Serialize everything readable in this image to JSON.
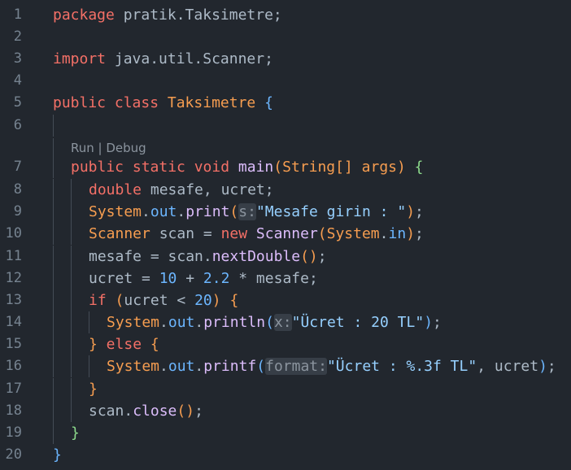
{
  "editor": {
    "line_numbers": [
      "1",
      "2",
      "3",
      "4",
      "5",
      "6",
      "7",
      "8",
      "9",
      "10",
      "11",
      "12",
      "13",
      "14",
      "15",
      "16",
      "17",
      "18",
      "19",
      "20"
    ],
    "codelens": {
      "run": "Run",
      "separator": " | ",
      "debug": "Debug"
    },
    "line1": {
      "kw": "package",
      "rest": " pratik.Taksimetre;"
    },
    "line3": {
      "kw": "import",
      "rest": " java.util.Scanner;"
    },
    "line5": {
      "kw": "public class",
      "name": " Taksimetre",
      "brace": " {"
    },
    "line7": {
      "kw": "public static void",
      "fn": " main",
      "open": "(",
      "type": "String[]",
      "arg": " args",
      "close": ")",
      "brace": " {"
    },
    "line8": {
      "type": "double",
      "rest": " mesafe, ucret;"
    },
    "line9": {
      "cls": "System",
      "dot1": ".",
      "field": "out",
      "dot2": ".",
      "fn": "print",
      "open": "(",
      "hint": "s:",
      "str": "\"Mesafe girin : \"",
      "close": ")",
      "end": ";"
    },
    "line10": {
      "type": "Scanner",
      "mid": " scan = ",
      "kw": "new",
      "sp": " ",
      "cls": "Scanner",
      "open": "(",
      "arg_cls": "System",
      "dot": ".",
      "field": "in",
      "close": ")",
      "end": ";"
    },
    "line11": {
      "pre": "mesafe = scan.",
      "fn": "nextDouble",
      "parens": "()",
      "end": ";"
    },
    "line12": {
      "pre": "ucret = ",
      "n1": "10",
      "op1": " + ",
      "n2": "2.2",
      "op2": " * mesafe;"
    },
    "line13": {
      "kw": "if",
      "sp": " ",
      "open": "(",
      "pre": "ucret < ",
      "num": "20",
      "close": ")",
      "brace": " {"
    },
    "line14": {
      "cls": "System",
      "dot1": ".",
      "field": "out",
      "dot2": ".",
      "fn": "println",
      "open": "(",
      "hint": "x:",
      "str": "\"Ücret : 20 TL\"",
      "close": ")",
      "end": ";"
    },
    "line15": {
      "close_brace": "}",
      "kw": " else",
      "brace": " {"
    },
    "line16": {
      "cls": "System",
      "dot1": ".",
      "field": "out",
      "dot2": ".",
      "fn": "printf",
      "open": "(",
      "hint": "format:",
      "str": "\"Ücret : %.3f TL\"",
      "rest": ", ucret",
      "close": ")",
      "end": ";"
    },
    "line17": {
      "brace": "}"
    },
    "line18": {
      "pre": "scan.",
      "fn": "close",
      "parens": "()",
      "end": ";"
    },
    "line19": {
      "brace": "}"
    },
    "line20": {
      "brace": "}"
    }
  },
  "colors": {
    "background": "#22272e",
    "keyword": "#f47067",
    "type": "#f69d50",
    "function": "#dcbdfb",
    "string": "#96d0ff",
    "number": "#6cb6ff",
    "line_number": "#768390"
  }
}
